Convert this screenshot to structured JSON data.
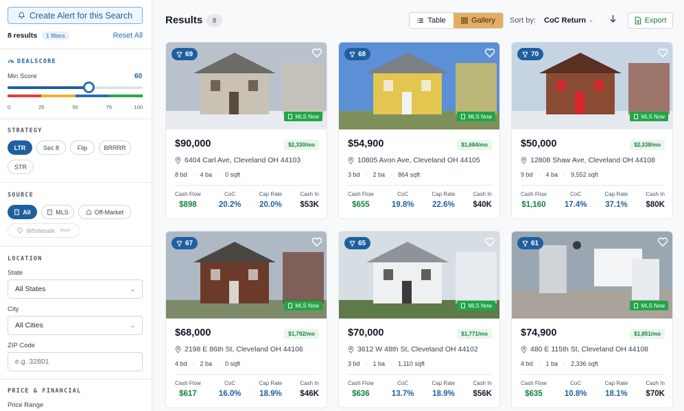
{
  "sidebar": {
    "alert_button": "Create Alert for this Search",
    "results_count": "8 results",
    "filters_badge": "1 filters",
    "reset": "Reset All",
    "dealscore": {
      "title": "DEALSCORE",
      "min_label": "Min Score",
      "min_value": "60",
      "min_fraction": 0.6,
      "ticks": [
        "0",
        "25",
        "50",
        "75",
        "100"
      ],
      "colors": [
        "#e23b3b",
        "#efb02c",
        "#2a6db0",
        "#27a745"
      ]
    },
    "strategy": {
      "title": "STRATEGY",
      "options": [
        "LTR",
        "Sec 8",
        "Flip",
        "BRRRR",
        "STR"
      ]
    },
    "source": {
      "title": "SOURCE",
      "options": [
        "All",
        "MLS",
        "Off-Market"
      ],
      "wholesale": "Wholesale",
      "soon": "Soon"
    },
    "location": {
      "title": "LOCATION",
      "state_label": "State",
      "state_value": "All States",
      "city_label": "City",
      "city_value": "All Cities",
      "zip_label": "ZIP Code",
      "zip_placeholder": "e.g. 32801"
    },
    "price_financial": {
      "title": "PRICE & FINANCIAL",
      "price_range_label": "Price Range"
    }
  },
  "header": {
    "title": "Results",
    "count": "8",
    "view_table": "Table",
    "view_gallery": "Gallery",
    "sort_label": "Sort by:",
    "sort_value": "CoC Return",
    "export": "Export"
  },
  "labels": {
    "cash_flow": "Cash Flow",
    "coc": "CoC",
    "cap_rate": "Cap Rate",
    "cash_in": "Cash In",
    "mls_now": "MLS Now"
  },
  "accent": "#1f5fa0",
  "listings": [
    {
      "score": "69",
      "price": "$90,000",
      "rent": "$2,330/mo",
      "address": "6404 Carl Ave, Cleveland OH 44103",
      "beds": "8 bd",
      "baths": "4 ba",
      "sqft": "0 sqft",
      "cash_flow": "$898",
      "coc": "20.2%",
      "cap_rate": "20.0%",
      "cash_in": "$53K"
    },
    {
      "score": "68",
      "price": "$54,900",
      "rent": "$1,684/mo",
      "address": "10805 Avon Ave, Cleveland OH 44105",
      "beds": "3 bd",
      "baths": "2 ba",
      "sqft": "864 sqft",
      "cash_flow": "$655",
      "coc": "19.8%",
      "cap_rate": "22.6%",
      "cash_in": "$40K"
    },
    {
      "score": "70",
      "price": "$50,000",
      "rent": "$2,338/mo",
      "address": "12808 Shaw Ave, Cleveland OH 44108",
      "beds": "9 bd",
      "baths": "4 ba",
      "sqft": "9,552 sqft",
      "cash_flow": "$1,160",
      "coc": "17.4%",
      "cap_rate": "37.1%",
      "cash_in": "$80K"
    },
    {
      "score": "67",
      "price": "$68,000",
      "rent": "$1,792/mo",
      "address": "2198 E 86th St, Cleveland OH 44106",
      "beds": "4 bd",
      "baths": "2 ba",
      "sqft": "0 sqft",
      "cash_flow": "$617",
      "coc": "16.0%",
      "cap_rate": "18.9%",
      "cash_in": "$46K"
    },
    {
      "score": "65",
      "price": "$70,000",
      "rent": "$1,771/mo",
      "address": "3612 W 48th St, Cleveland OH 44102",
      "beds": "3 bd",
      "baths": "1 ba",
      "sqft": "1,110 sqft",
      "cash_flow": "$636",
      "coc": "13.7%",
      "cap_rate": "18.9%",
      "cash_in": "$56K"
    },
    {
      "score": "61",
      "price": "$74,900",
      "rent": "$1,851/mo",
      "address": "480 E 115th St, Cleveland OH 44108",
      "beds": "4 bd",
      "baths": "1 ba",
      "sqft": "2,336 sqft",
      "cash_flow": "$635",
      "coc": "10.8%",
      "cap_rate": "18.1%",
      "cash_in": "$70K"
    }
  ]
}
